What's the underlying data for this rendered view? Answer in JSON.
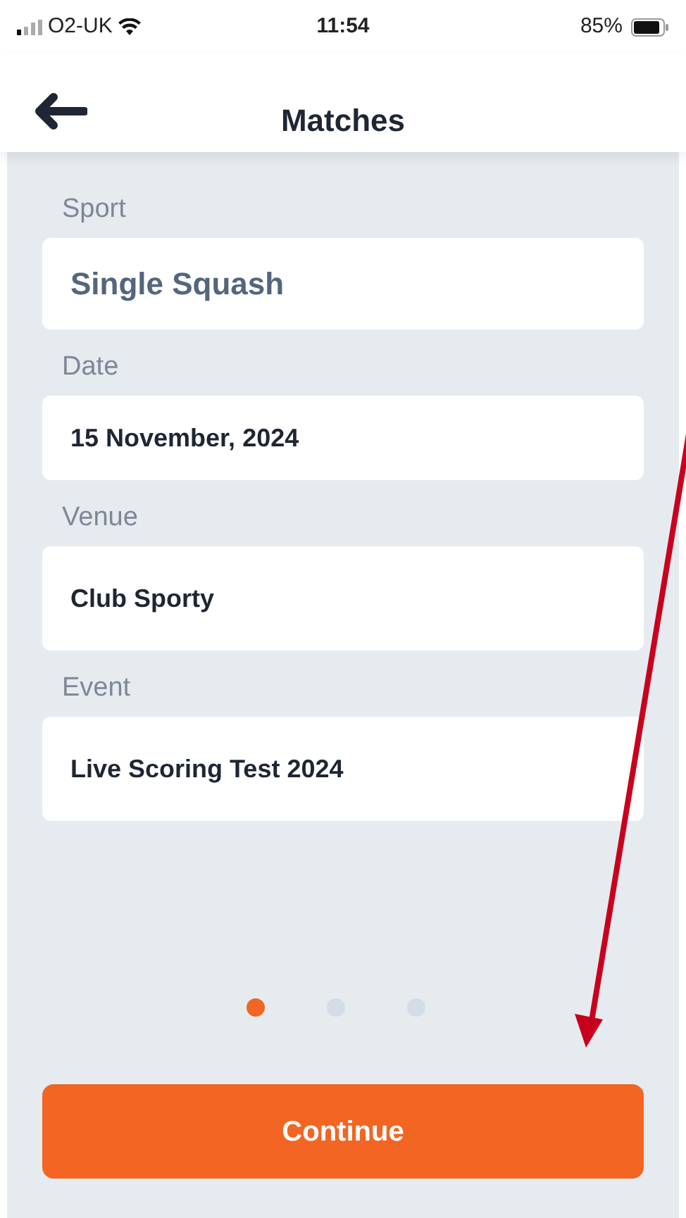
{
  "status_bar": {
    "carrier": "O2-UK",
    "time": "11:54",
    "battery": "85%"
  },
  "header": {
    "title": "Matches"
  },
  "fields": [
    {
      "label": "Sport",
      "value": "Single Squash",
      "kind": "large"
    },
    {
      "label": "Date",
      "value": "15 November, 2024",
      "kind": "normal"
    },
    {
      "label": "Venue",
      "value": "Club Sporty",
      "kind": "tall"
    },
    {
      "label": "Event",
      "value": "Live Scoring Test 2024",
      "kind": "tall"
    }
  ],
  "pager": [
    {
      "selected": true
    },
    {
      "selected": false
    },
    {
      "selected": false
    }
  ],
  "button": {
    "label": "Continue"
  }
}
